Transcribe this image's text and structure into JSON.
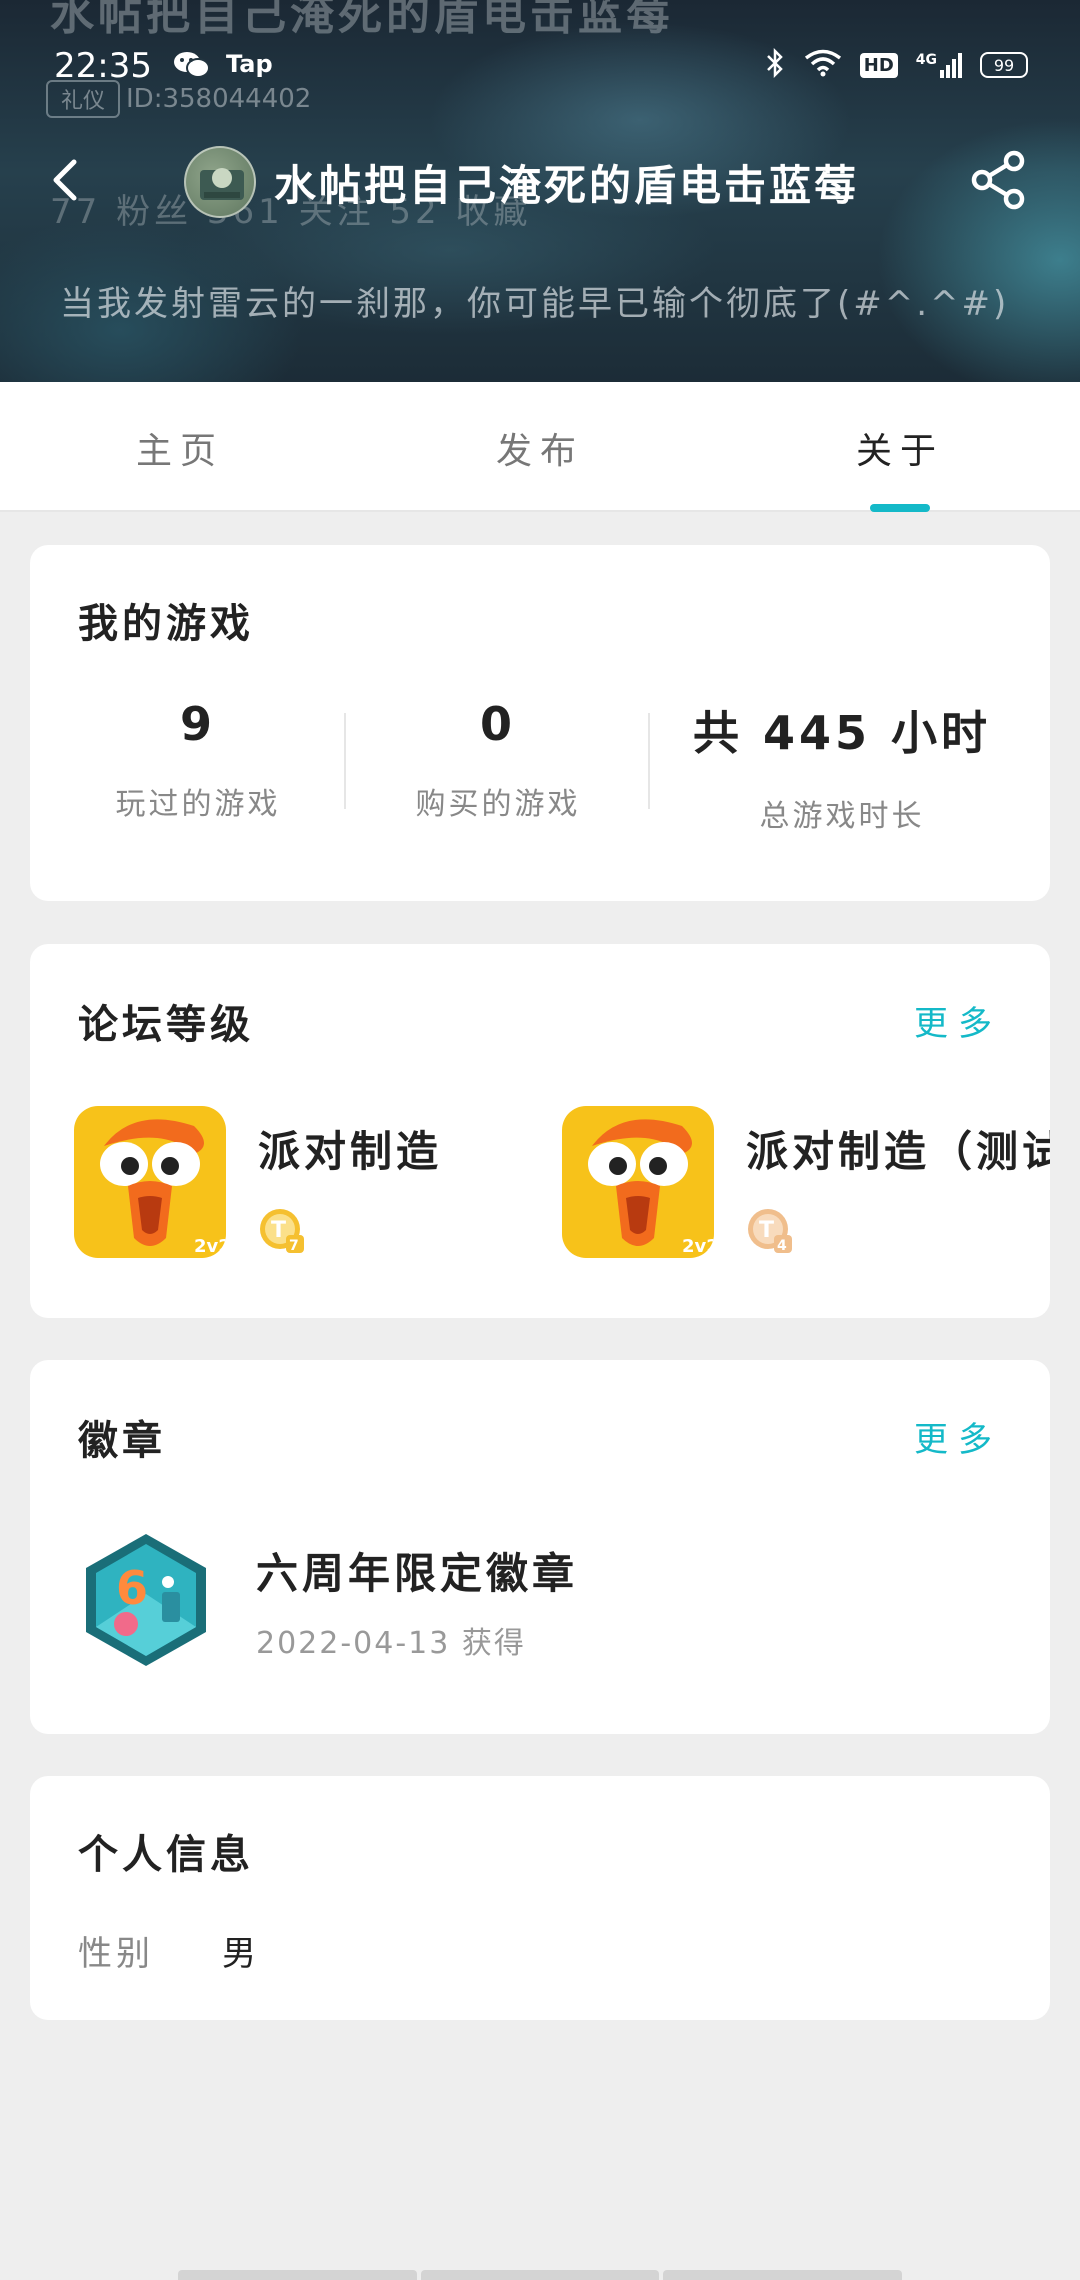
{
  "status_bar": {
    "time": "22:35",
    "app_label": "Tap",
    "network": "4G",
    "hd": "HD",
    "battery": "99"
  },
  "profile": {
    "username": "水帖把自己淹死的盾电击蓝莓",
    "tag": "礼仪",
    "id": "ID:358044402",
    "stats": "77 粉丝   361 关注   52 收藏",
    "bio": "当我发射雷云的一刹那，你可能早已输个彻底了(#^.^#)"
  },
  "tabs": [
    {
      "label": "主页",
      "active": false
    },
    {
      "label": "发布",
      "active": false
    },
    {
      "label": "关于",
      "active": true
    }
  ],
  "colors": {
    "accent": "#14b9c8"
  },
  "my_games": {
    "title": "我的游戏",
    "stats": [
      {
        "value": "9",
        "label": "玩过的游戏"
      },
      {
        "value": "0",
        "label": "购买的游戏"
      },
      {
        "value": "共 445 小时",
        "label": "总游戏时长"
      }
    ]
  },
  "forum_level": {
    "title": "论坛等级",
    "more": "更多",
    "items": [
      {
        "name": "派对制造",
        "level": "7"
      },
      {
        "name": "派对制造（测试",
        "level": "4"
      }
    ]
  },
  "badges": {
    "title": "徽章",
    "more": "更多",
    "items": [
      {
        "name": "六周年限定徽章",
        "date": "2022-04-13 获得"
      }
    ]
  },
  "personal_info": {
    "title": "个人信息",
    "gender_label": "性别",
    "gender_value": "男"
  }
}
